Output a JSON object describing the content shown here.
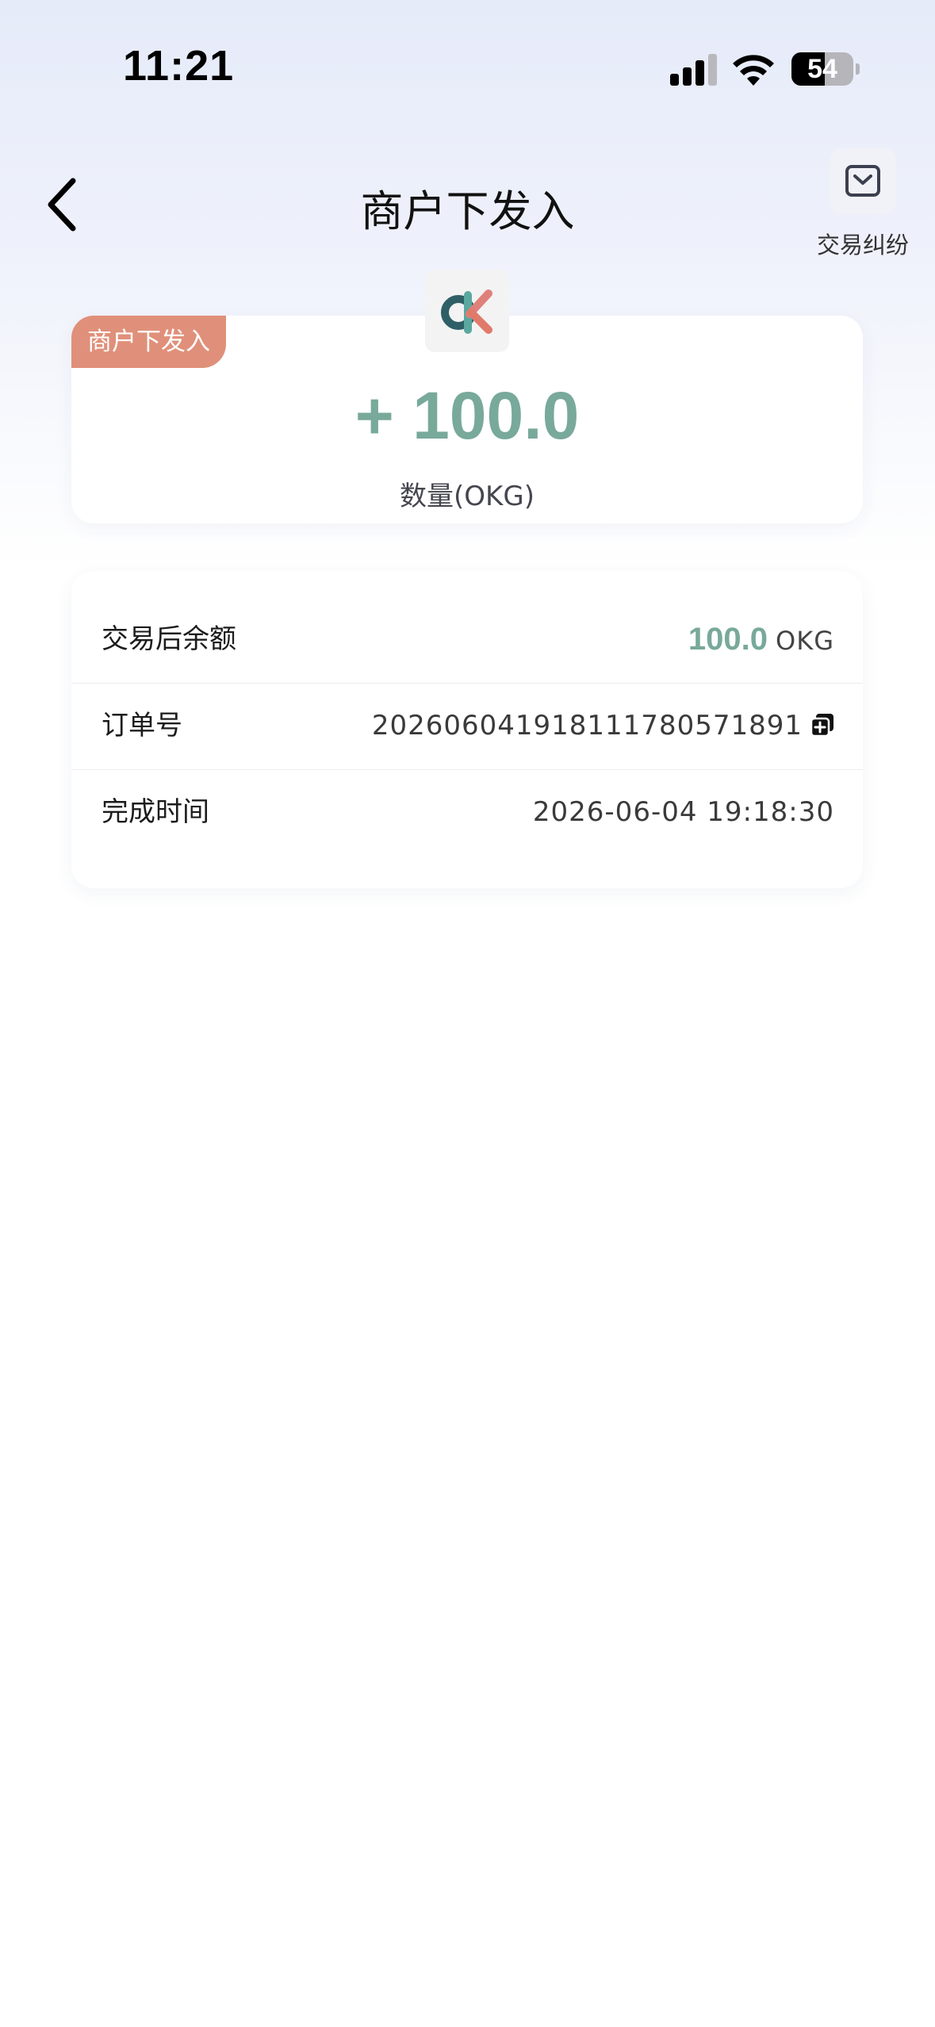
{
  "status_bar": {
    "time": "11:21",
    "battery_level": "54",
    "signal_bars": 3,
    "icons": [
      "cellular-signal-icon",
      "wifi-icon",
      "battery-icon"
    ]
  },
  "header": {
    "title": "商户下发入",
    "back_icon": "chevron-left-icon",
    "dispute": {
      "label": "交易纠纷",
      "icon": "chevron-down-box-icon"
    }
  },
  "amount_card": {
    "tag": "商户下发入",
    "amount": "+ 100.0",
    "unit_label": "数量(OKG)",
    "logo": "okg-logo",
    "amount_color": "#78a99a",
    "tag_color": "#e0907a"
  },
  "details": {
    "balance": {
      "label": "交易后余额",
      "value": "100.0",
      "unit": "OKG"
    },
    "order": {
      "label": "订单号",
      "value": "20260604191811178057189​1",
      "copy_icon": "copy-icon"
    },
    "completed": {
      "label": "完成时间",
      "value": "2026-06-04 19:18:30"
    }
  }
}
